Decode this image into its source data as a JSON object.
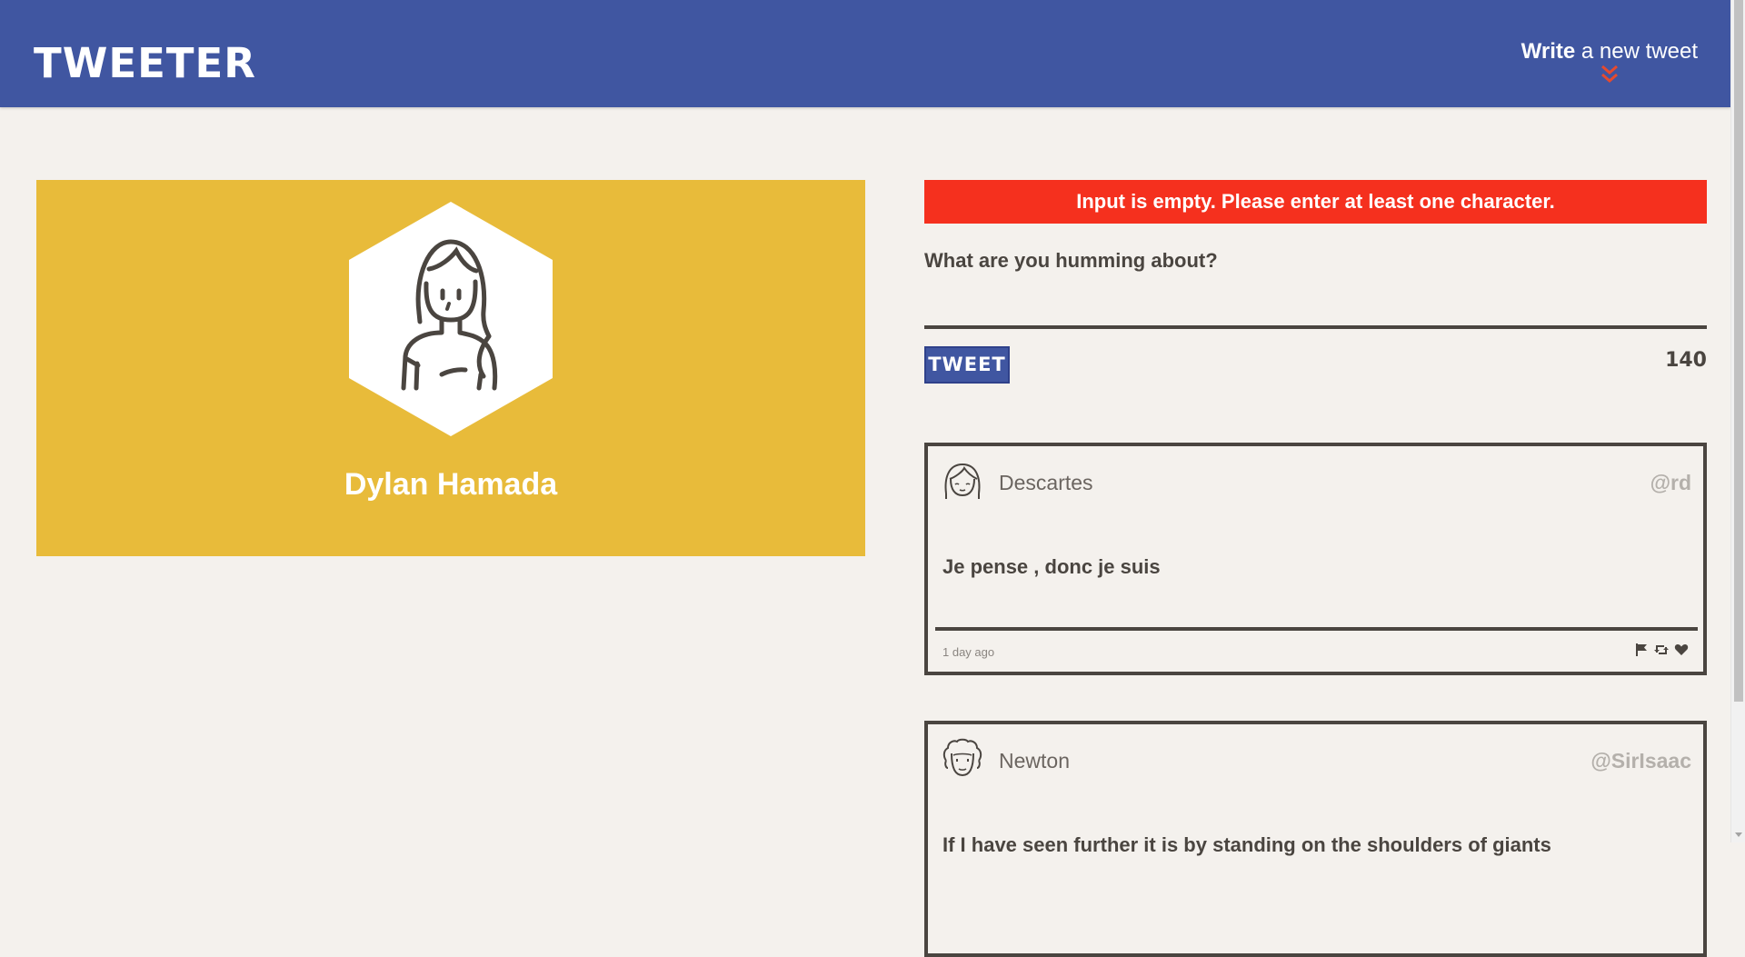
{
  "header": {
    "logo": "TWEETER",
    "compose_toggle_bold": "Write",
    "compose_toggle_rest": " a new tweet",
    "compose_toggle_icon": "double-chevron-down-icon"
  },
  "colors": {
    "header_bg": "#4056a1",
    "page_bg": "#f4f1ed",
    "profile_bg": "#e8bb3a",
    "error_bg": "#f5301e",
    "accent_chevron": "#e64a2e",
    "ink": "#4a4540"
  },
  "profile": {
    "name": "Dylan Hamada",
    "avatar_icon": "woman-avatar-icon"
  },
  "compose": {
    "error_message": "Input is empty. Please enter at least one character.",
    "label": "What are you humming about?",
    "textarea_value": "",
    "button_label": "TWEET",
    "counter": "140"
  },
  "tweets": [
    {
      "author": "Descartes",
      "handle": "@rd",
      "avatar_icon": "girl-avatar-icon",
      "text": "Je pense , donc je suis",
      "time": "1 day ago",
      "actions": [
        "flag-icon",
        "retweet-icon",
        "heart-icon"
      ]
    },
    {
      "author": "Newton",
      "handle": "@SirIsaac",
      "avatar_icon": "curly-hair-avatar-icon",
      "text": "If I have seen further it is by standing on the shoulders of giants"
    }
  ]
}
